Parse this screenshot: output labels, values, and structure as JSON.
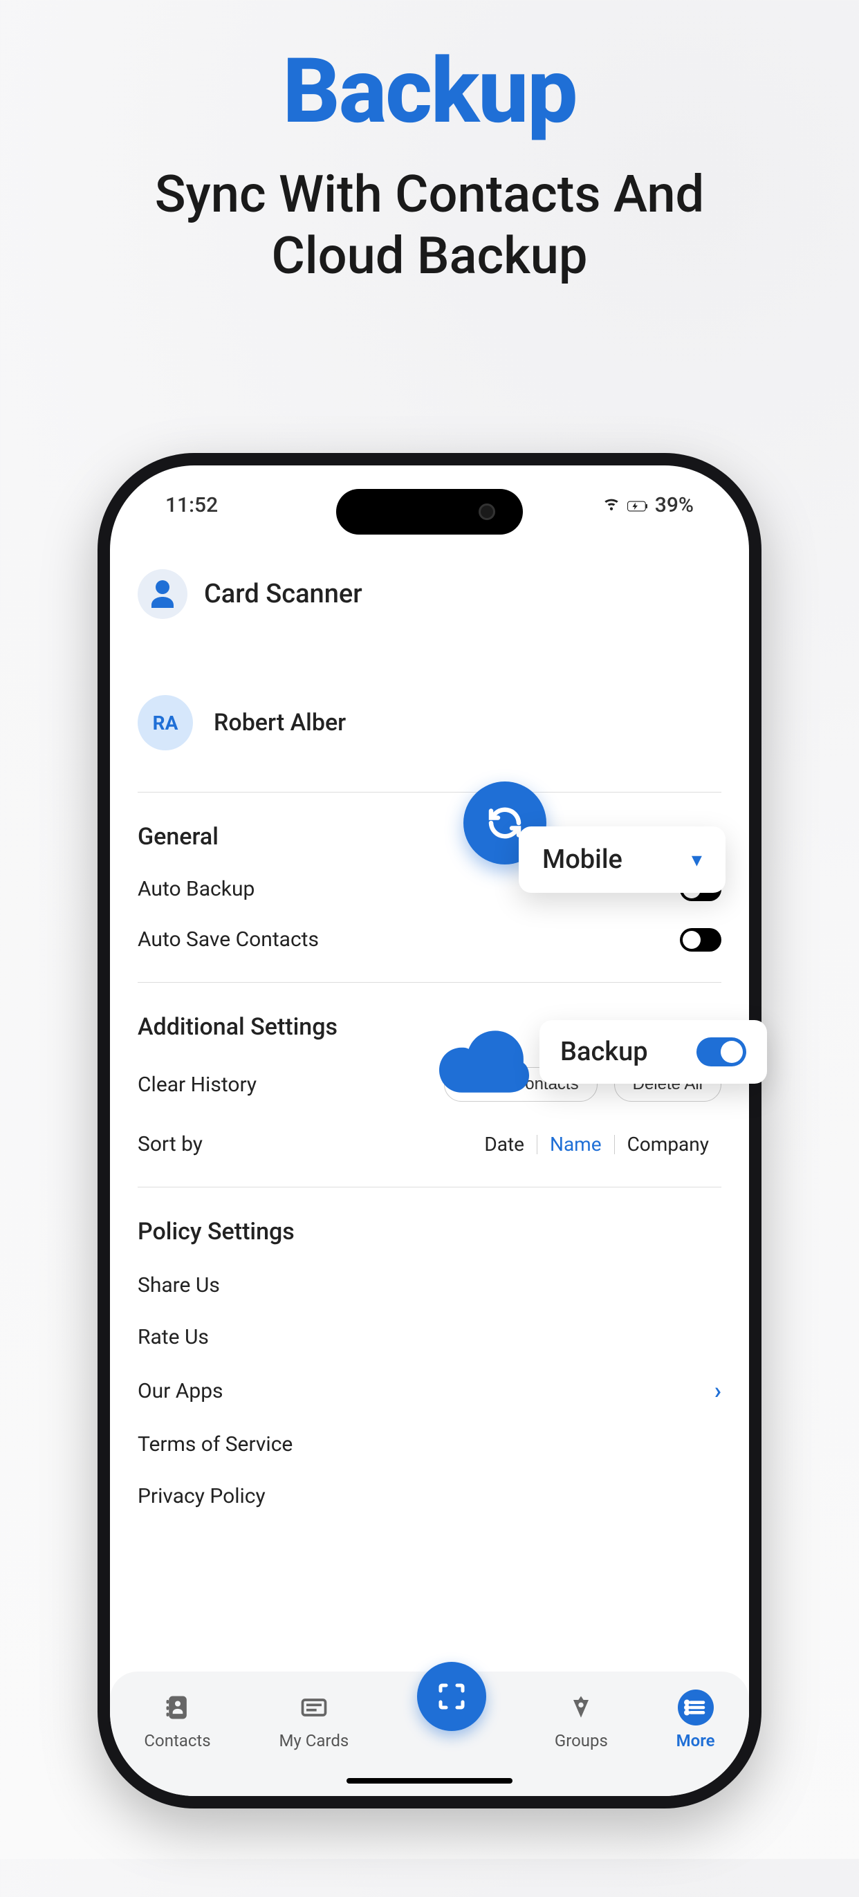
{
  "hero": {
    "title": "Backup",
    "subtitle_line1": "Sync With Contacts And",
    "subtitle_line2": "Cloud Backup"
  },
  "status": {
    "time": "11:52",
    "battery": "39%"
  },
  "app": {
    "title": "Card Scanner"
  },
  "user": {
    "initials": "RA",
    "name": "Robert Alber"
  },
  "sections": {
    "general": {
      "title": "General",
      "auto_backup": "Auto Backup",
      "auto_save_contacts": "Auto Save Contacts"
    },
    "additional": {
      "title": "Additional Settings",
      "clear_history": "Clear History",
      "select_contacts": "Select Contacts",
      "delete_all": "Delete All",
      "sort_by": "Sort by",
      "sort_options": {
        "date": "Date",
        "name": "Name",
        "company": "Company"
      }
    },
    "policy": {
      "title": "Policy Settings",
      "share_us": "Share Us",
      "rate_us": "Rate Us",
      "our_apps": "Our Apps",
      "terms": "Terms of Service",
      "privacy": "Privacy Policy"
    }
  },
  "tabs": {
    "contacts": "Contacts",
    "my_cards": "My Cards",
    "groups": "Groups",
    "more": "More"
  },
  "callouts": {
    "mobile": "Mobile",
    "backup": "Backup"
  }
}
